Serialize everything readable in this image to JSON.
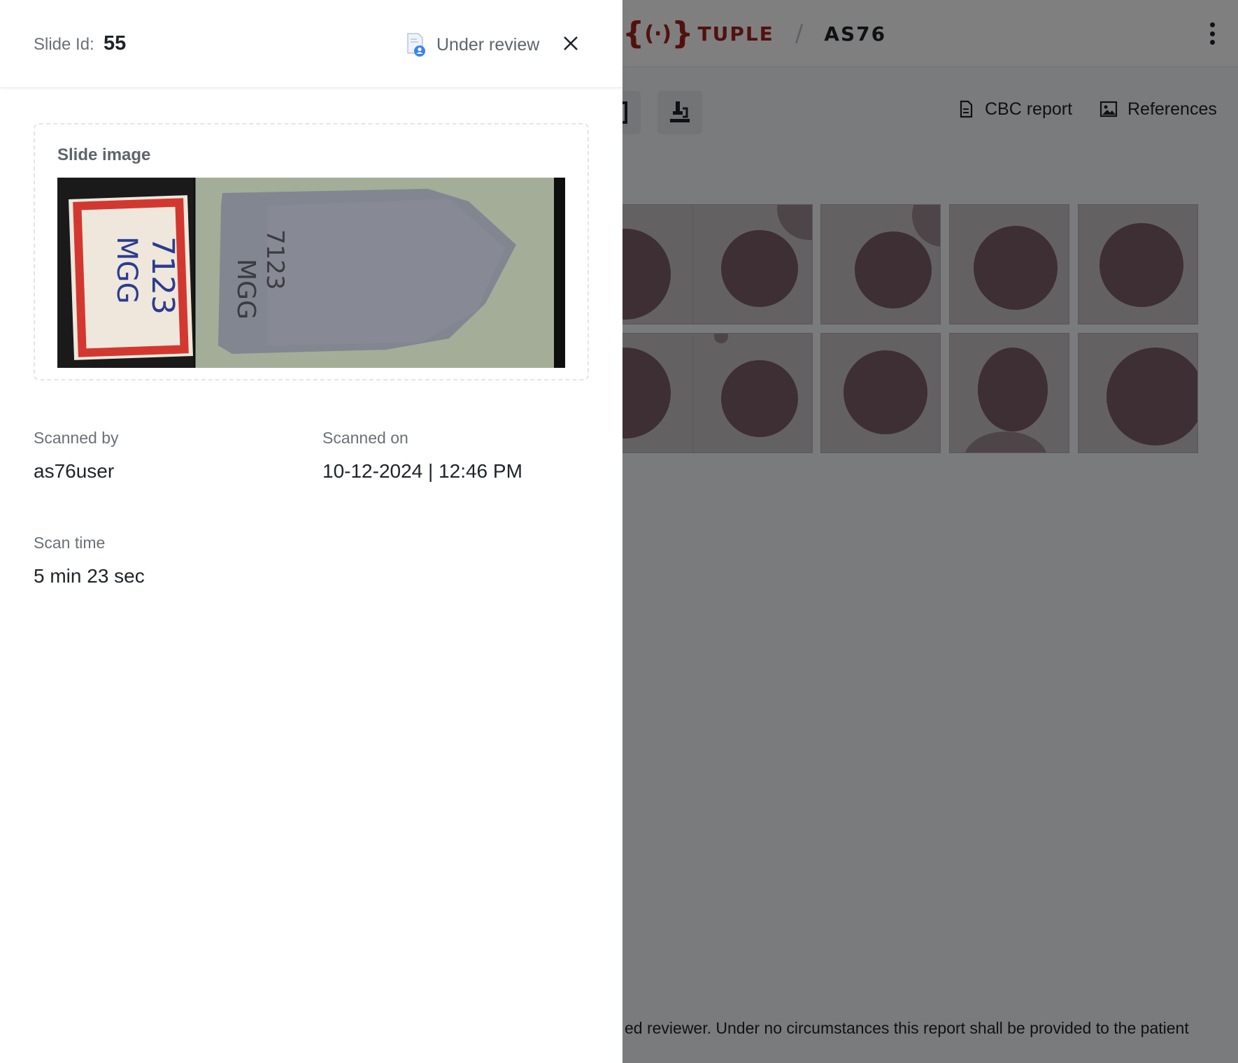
{
  "header": {
    "brand_name": "TUPLE",
    "brand_separator": "/",
    "product": "AS76",
    "menu_icon": "more-vertical-icon"
  },
  "toolbar": {
    "buttons": [
      {
        "icon": "square-icon"
      },
      {
        "icon": "microscope-icon"
      }
    ],
    "cbc_report": "CBC report",
    "references": "References"
  },
  "footer": {
    "disclaimer": "ed reviewer. Under no circumstances this report shall be provided to the patient"
  },
  "drawer": {
    "slide_id_label": "Slide Id:",
    "slide_id": "55",
    "status": "Under review",
    "status_icon": "user-document-icon",
    "close_icon": "close-icon",
    "slide_image_title": "Slide image",
    "slide_label_text": [
      "7123",
      "MGG"
    ],
    "slide_etched_text": [
      "7123",
      "MGG"
    ],
    "scanned_by_label": "Scanned by",
    "scanned_by": "as76user",
    "scanned_on_label": "Scanned on",
    "scanned_on": "10-12-2024 | 12:46 PM",
    "scan_time_label": "Scan time",
    "scan_time": "5 min 23 sec"
  },
  "colors": {
    "brand": "#a3241d",
    "overlay": "rgba(0,0,0,0.5)",
    "status_icon_accent": "#3b82f6"
  }
}
